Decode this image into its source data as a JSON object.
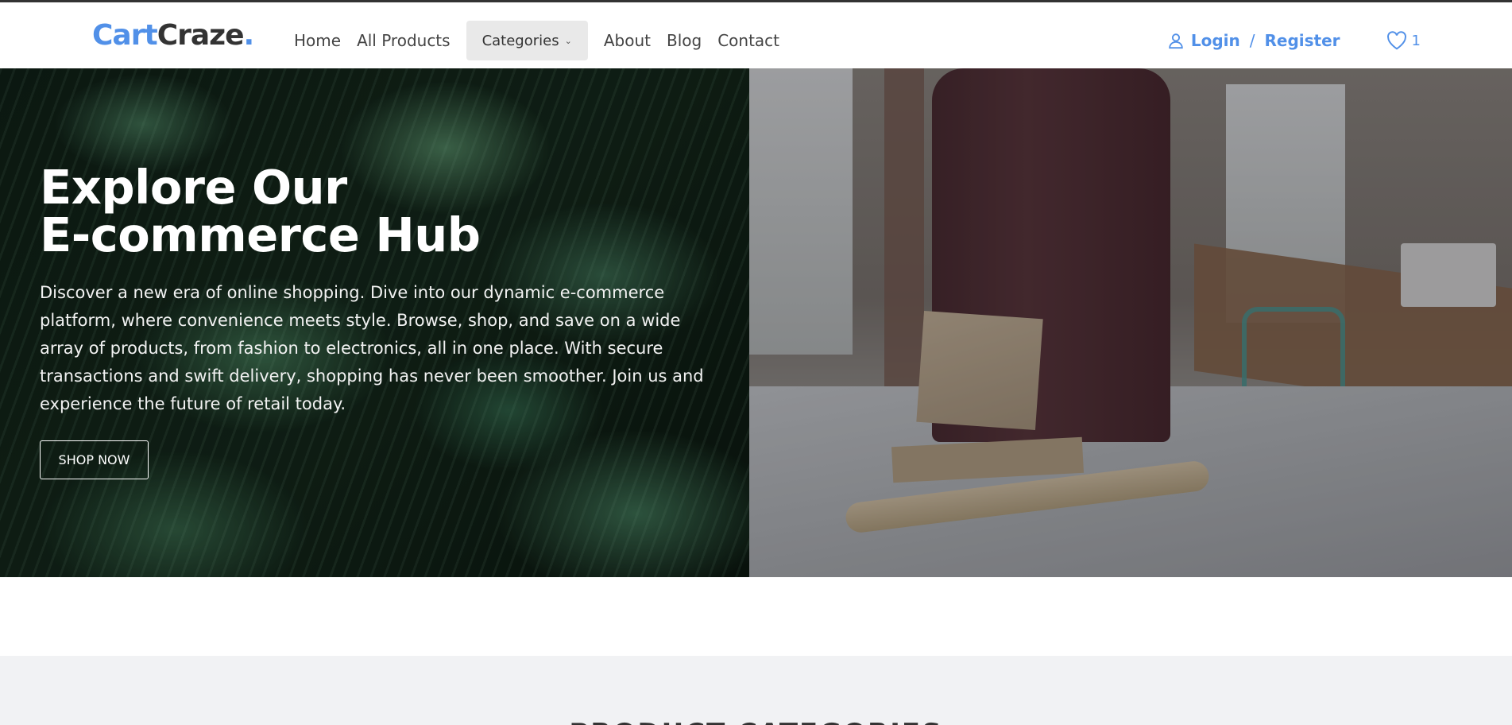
{
  "brand": {
    "part1": "Cart",
    "part2": "Craze",
    "part3": "."
  },
  "nav": {
    "links": [
      "Home",
      "All Products"
    ],
    "dropdown_label": "Categories",
    "links_after": [
      "About",
      "Blog",
      "Contact"
    ]
  },
  "auth": {
    "login": "Login",
    "separator": "/",
    "register": "Register"
  },
  "wishlist": {
    "count": "1"
  },
  "hero": {
    "title_line1": "Explore Our",
    "title_line2": "E-commerce Hub",
    "description": "Discover a new era of online shopping. Dive into our dynamic e-commerce platform, where convenience meets style. Browse, shop, and save on a wide array of products, from fashion to electronics, all in one place. With secure transactions and swift delivery, shopping has never been smoother. Join us and experience the future of retail today.",
    "cta": "SHOP NOW"
  },
  "section": {
    "title": "PRODUCT CATEGORIES"
  },
  "colors": {
    "accent": "#5190e8",
    "dark_text": "#333333",
    "section_bg": "#f1f2f4"
  }
}
